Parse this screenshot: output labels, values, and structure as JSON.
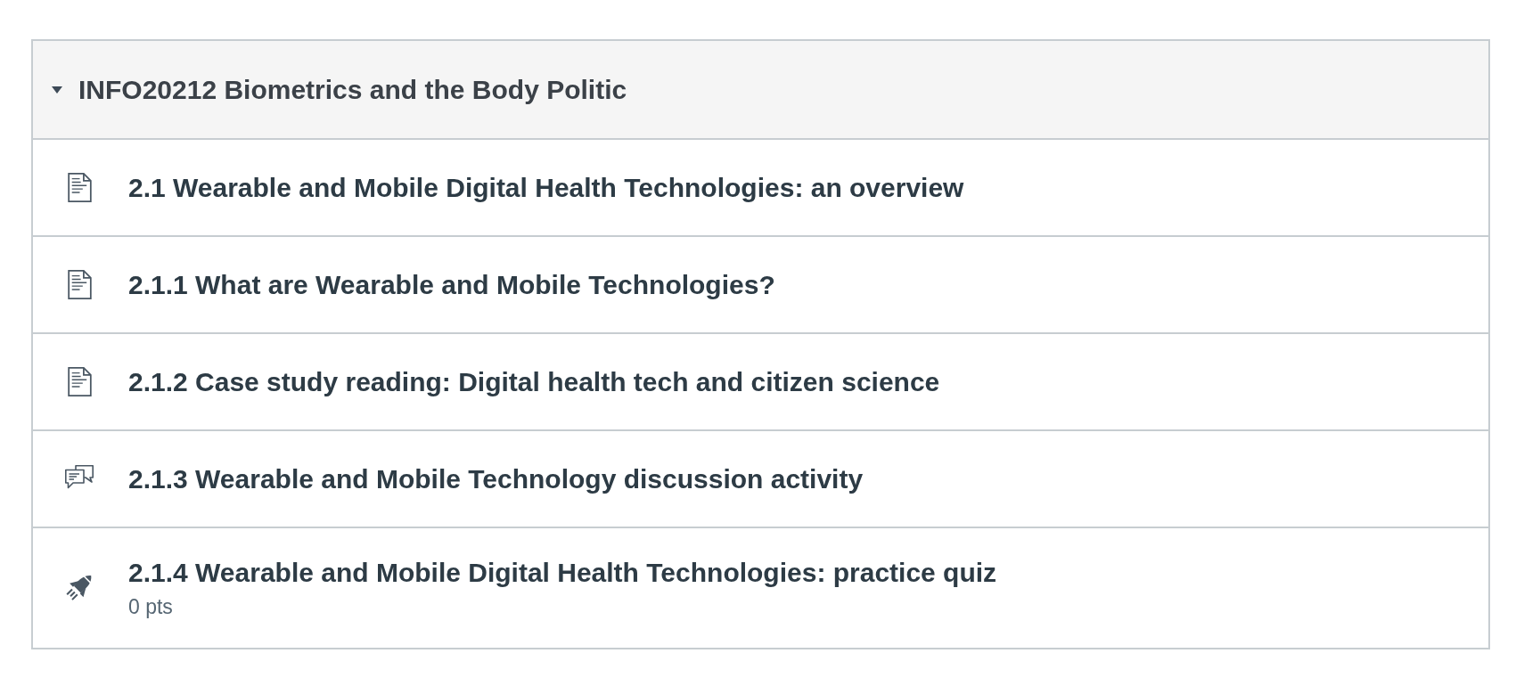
{
  "module": {
    "title": "INFO20212 Biometrics and the Body Politic",
    "expanded": true,
    "items": [
      {
        "kind": "page",
        "title": "2.1 Wearable and Mobile Digital Health Technologies: an overview"
      },
      {
        "kind": "page",
        "title": "2.1.1 What are Wearable and Mobile Technologies?"
      },
      {
        "kind": "page",
        "title": "2.1.2 Case study reading: Digital health tech and citizen science"
      },
      {
        "kind": "discussion",
        "title": "2.1.3 Wearable and Mobile Technology discussion activity"
      },
      {
        "kind": "quiz",
        "title": "2.1.4 Wearable and Mobile Digital Health Technologies: practice quiz",
        "points": "0 pts"
      }
    ]
  }
}
